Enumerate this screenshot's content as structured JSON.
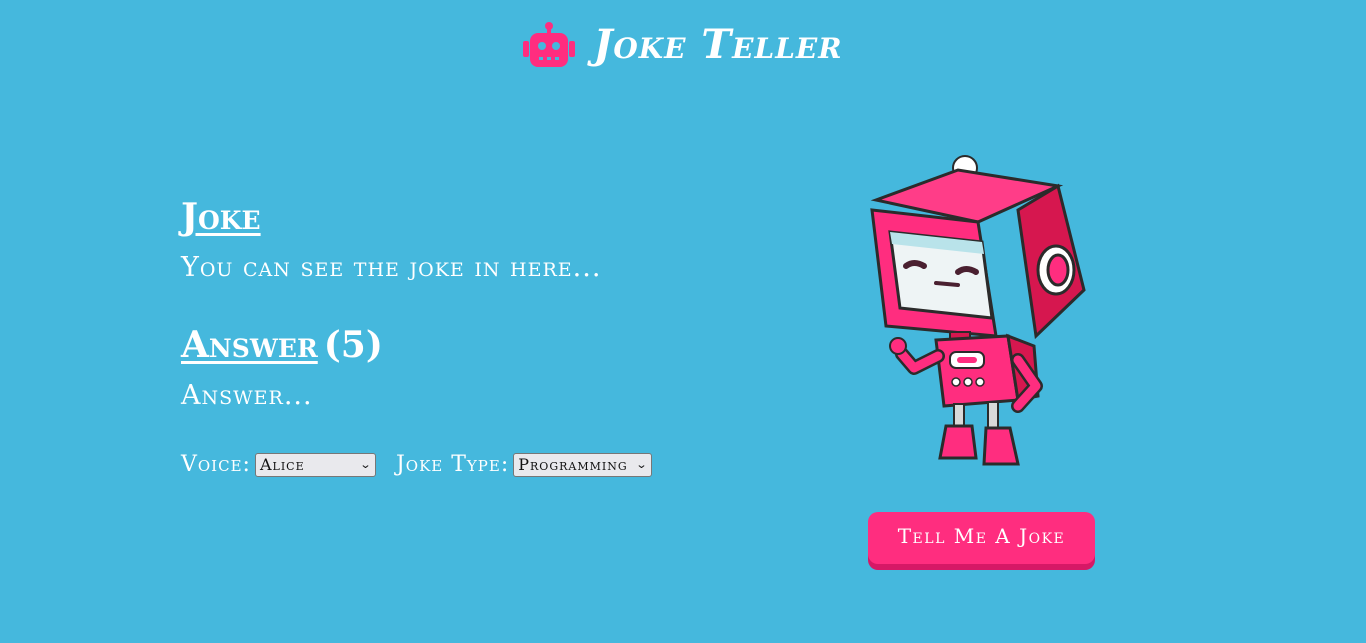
{
  "header": {
    "title": "Joke Teller",
    "icon": "robot-icon"
  },
  "joke": {
    "heading": "Joke",
    "text": "You can see the joke in here..."
  },
  "answer": {
    "heading": "Answer",
    "countdown": "(5)",
    "text": "Answer..."
  },
  "controls": {
    "voice_label": "Voice:",
    "voice_selected": "Alice",
    "joke_type_label": "Joke Type:",
    "joke_type_selected": "Programming"
  },
  "action": {
    "button_label": "Tell Me A Joke"
  },
  "colors": {
    "background": "#45b8dd",
    "accent": "#ff2d7f",
    "accent_shadow": "#d61866",
    "text": "#ffffff"
  }
}
